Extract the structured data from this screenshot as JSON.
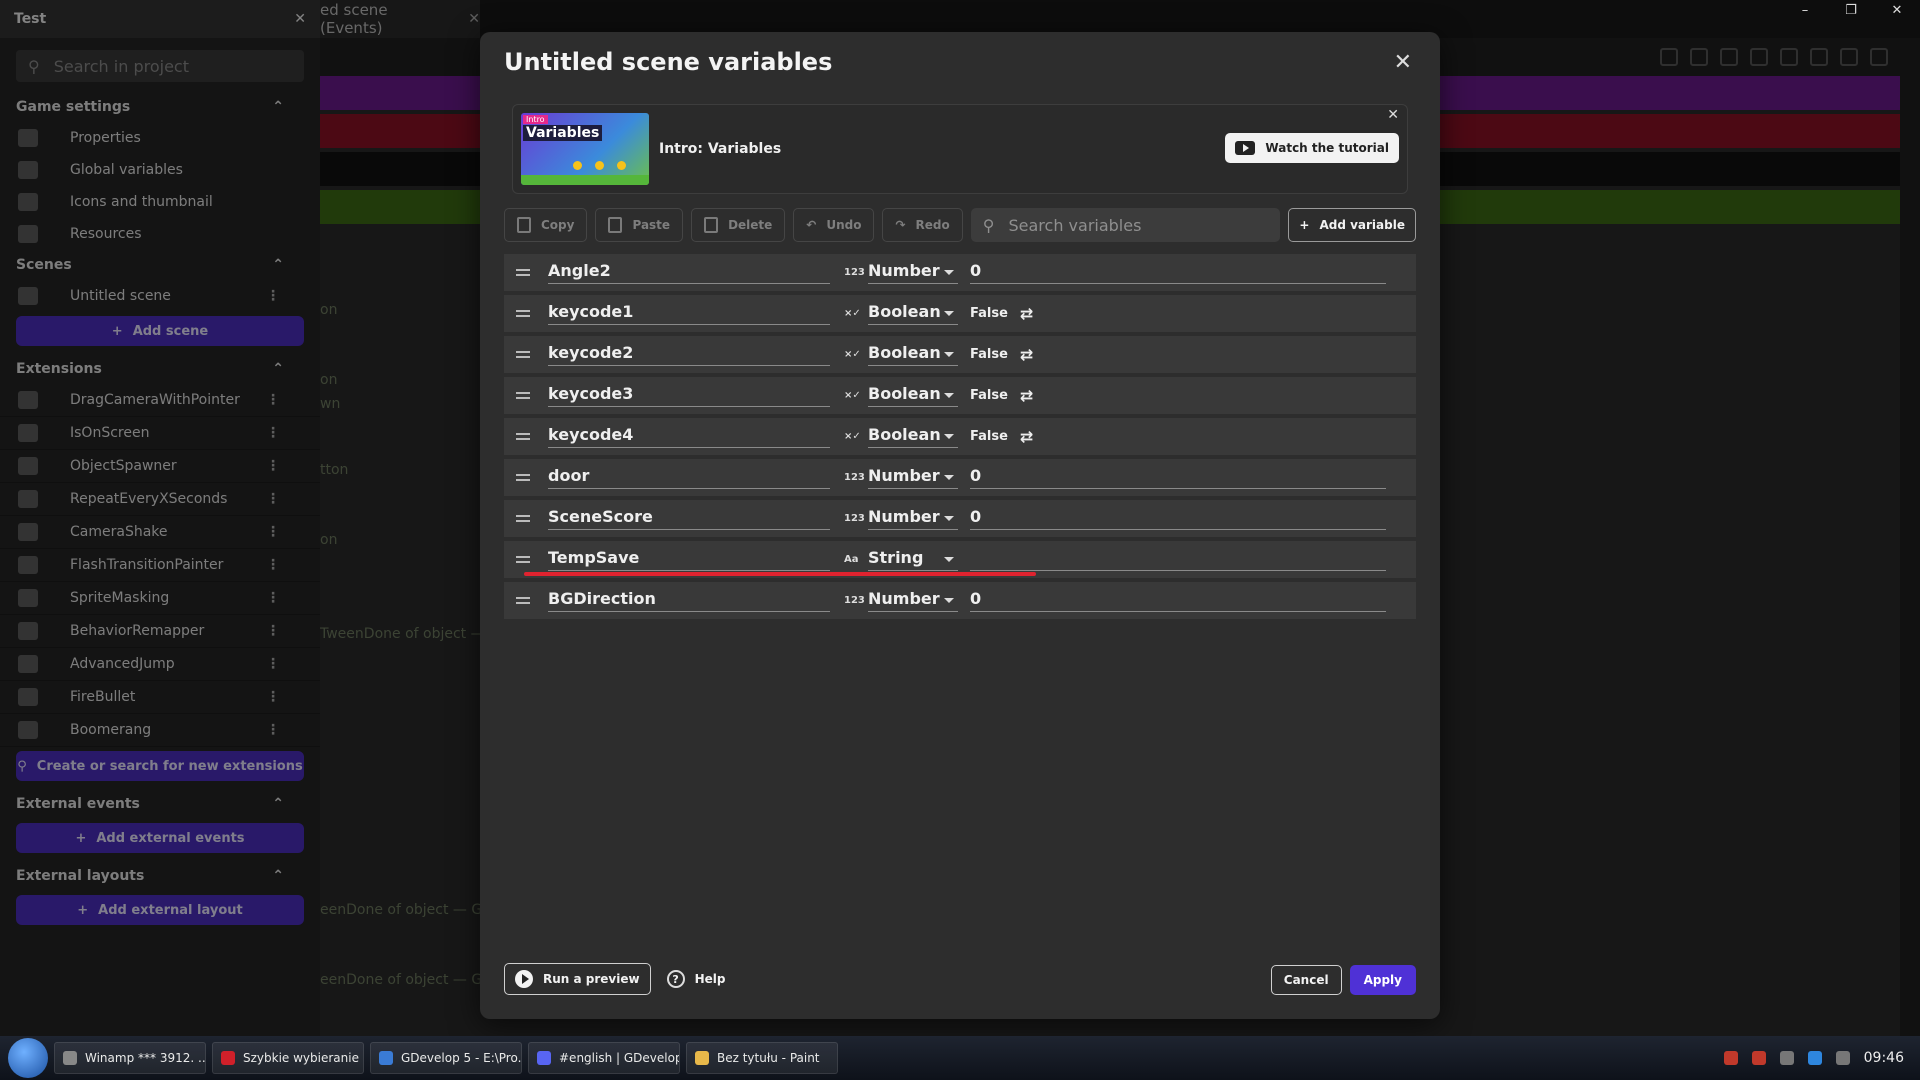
{
  "window": {
    "minimize": "–",
    "restore": "❐",
    "close": "✕"
  },
  "editor_tab": {
    "label": "ed scene (Events)",
    "close": "✕"
  },
  "background_texts": [
    "on",
    "on",
    "wn",
    "tton",
    "on",
    "TweenDone of object —",
    "eenDone of object — Ga",
    "eenDone of object — Ga"
  ],
  "sidebar": {
    "project_title": "Test",
    "search_placeholder": "Search in project",
    "game_settings": {
      "title": "Game settings",
      "items": [
        "Properties",
        "Global variables",
        "Icons and thumbnail",
        "Resources"
      ]
    },
    "scenes": {
      "title": "Scenes",
      "items": [
        "Untitled scene"
      ],
      "add_label": "Add scene"
    },
    "extensions": {
      "title": "Extensions",
      "items": [
        "DragCameraWithPointer",
        "IsOnScreen",
        "ObjectSpawner",
        "RepeatEveryXSeconds",
        "CameraShake",
        "FlashTransitionPainter",
        "SpriteMasking",
        "BehaviorRemapper",
        "AdvancedJump",
        "FireBullet",
        "Boomerang"
      ],
      "search_label": "Create or search for new extensions"
    },
    "external_events": {
      "title": "External events",
      "add_label": "Add external events"
    },
    "external_layouts": {
      "title": "External layouts",
      "add_label": "Add external layout"
    }
  },
  "dialog": {
    "title": "Untitled scene variables",
    "tutorial": {
      "tag": "Intro",
      "thumb_title": "Variables",
      "label": "Intro: Variables",
      "watch_label": "Watch the tutorial"
    },
    "toolbar": {
      "copy": "Copy",
      "paste": "Paste",
      "delete": "Delete",
      "undo": "Undo",
      "redo": "Redo",
      "search_placeholder": "Search variables",
      "add": "Add variable"
    },
    "variables": [
      {
        "name": "Angle2",
        "type_icon": "123",
        "type": "Number",
        "value": "0"
      },
      {
        "name": "keycode1",
        "type_icon": "×✓",
        "type": "Boolean",
        "value": "False"
      },
      {
        "name": "keycode2",
        "type_icon": "×✓",
        "type": "Boolean",
        "value": "False"
      },
      {
        "name": "keycode3",
        "type_icon": "×✓",
        "type": "Boolean",
        "value": "False"
      },
      {
        "name": "keycode4",
        "type_icon": "×✓",
        "type": "Boolean",
        "value": "False"
      },
      {
        "name": "door",
        "type_icon": "123",
        "type": "Number",
        "value": "0"
      },
      {
        "name": "SceneScore",
        "type_icon": "123",
        "type": "Number",
        "value": "0"
      },
      {
        "name": "TempSave",
        "type_icon": "Aa",
        "type": "String",
        "value": ""
      },
      {
        "name": "BGDirection",
        "type_icon": "123",
        "type": "Number",
        "value": "0"
      }
    ],
    "footer": {
      "preview": "Run a preview",
      "help": "Help",
      "cancel": "Cancel",
      "apply": "Apply"
    }
  },
  "taskbar": {
    "apps": [
      "Winamp *** 3912. ...",
      "Szybkie wybieranie ...",
      "GDevelop 5 - E:\\Pro...",
      "#english | GDevelop...",
      "Bez tytułu - Paint"
    ],
    "clock": "09:46"
  },
  "colors": {
    "accent": "#4f31d6",
    "highlight": "#e0232f"
  }
}
